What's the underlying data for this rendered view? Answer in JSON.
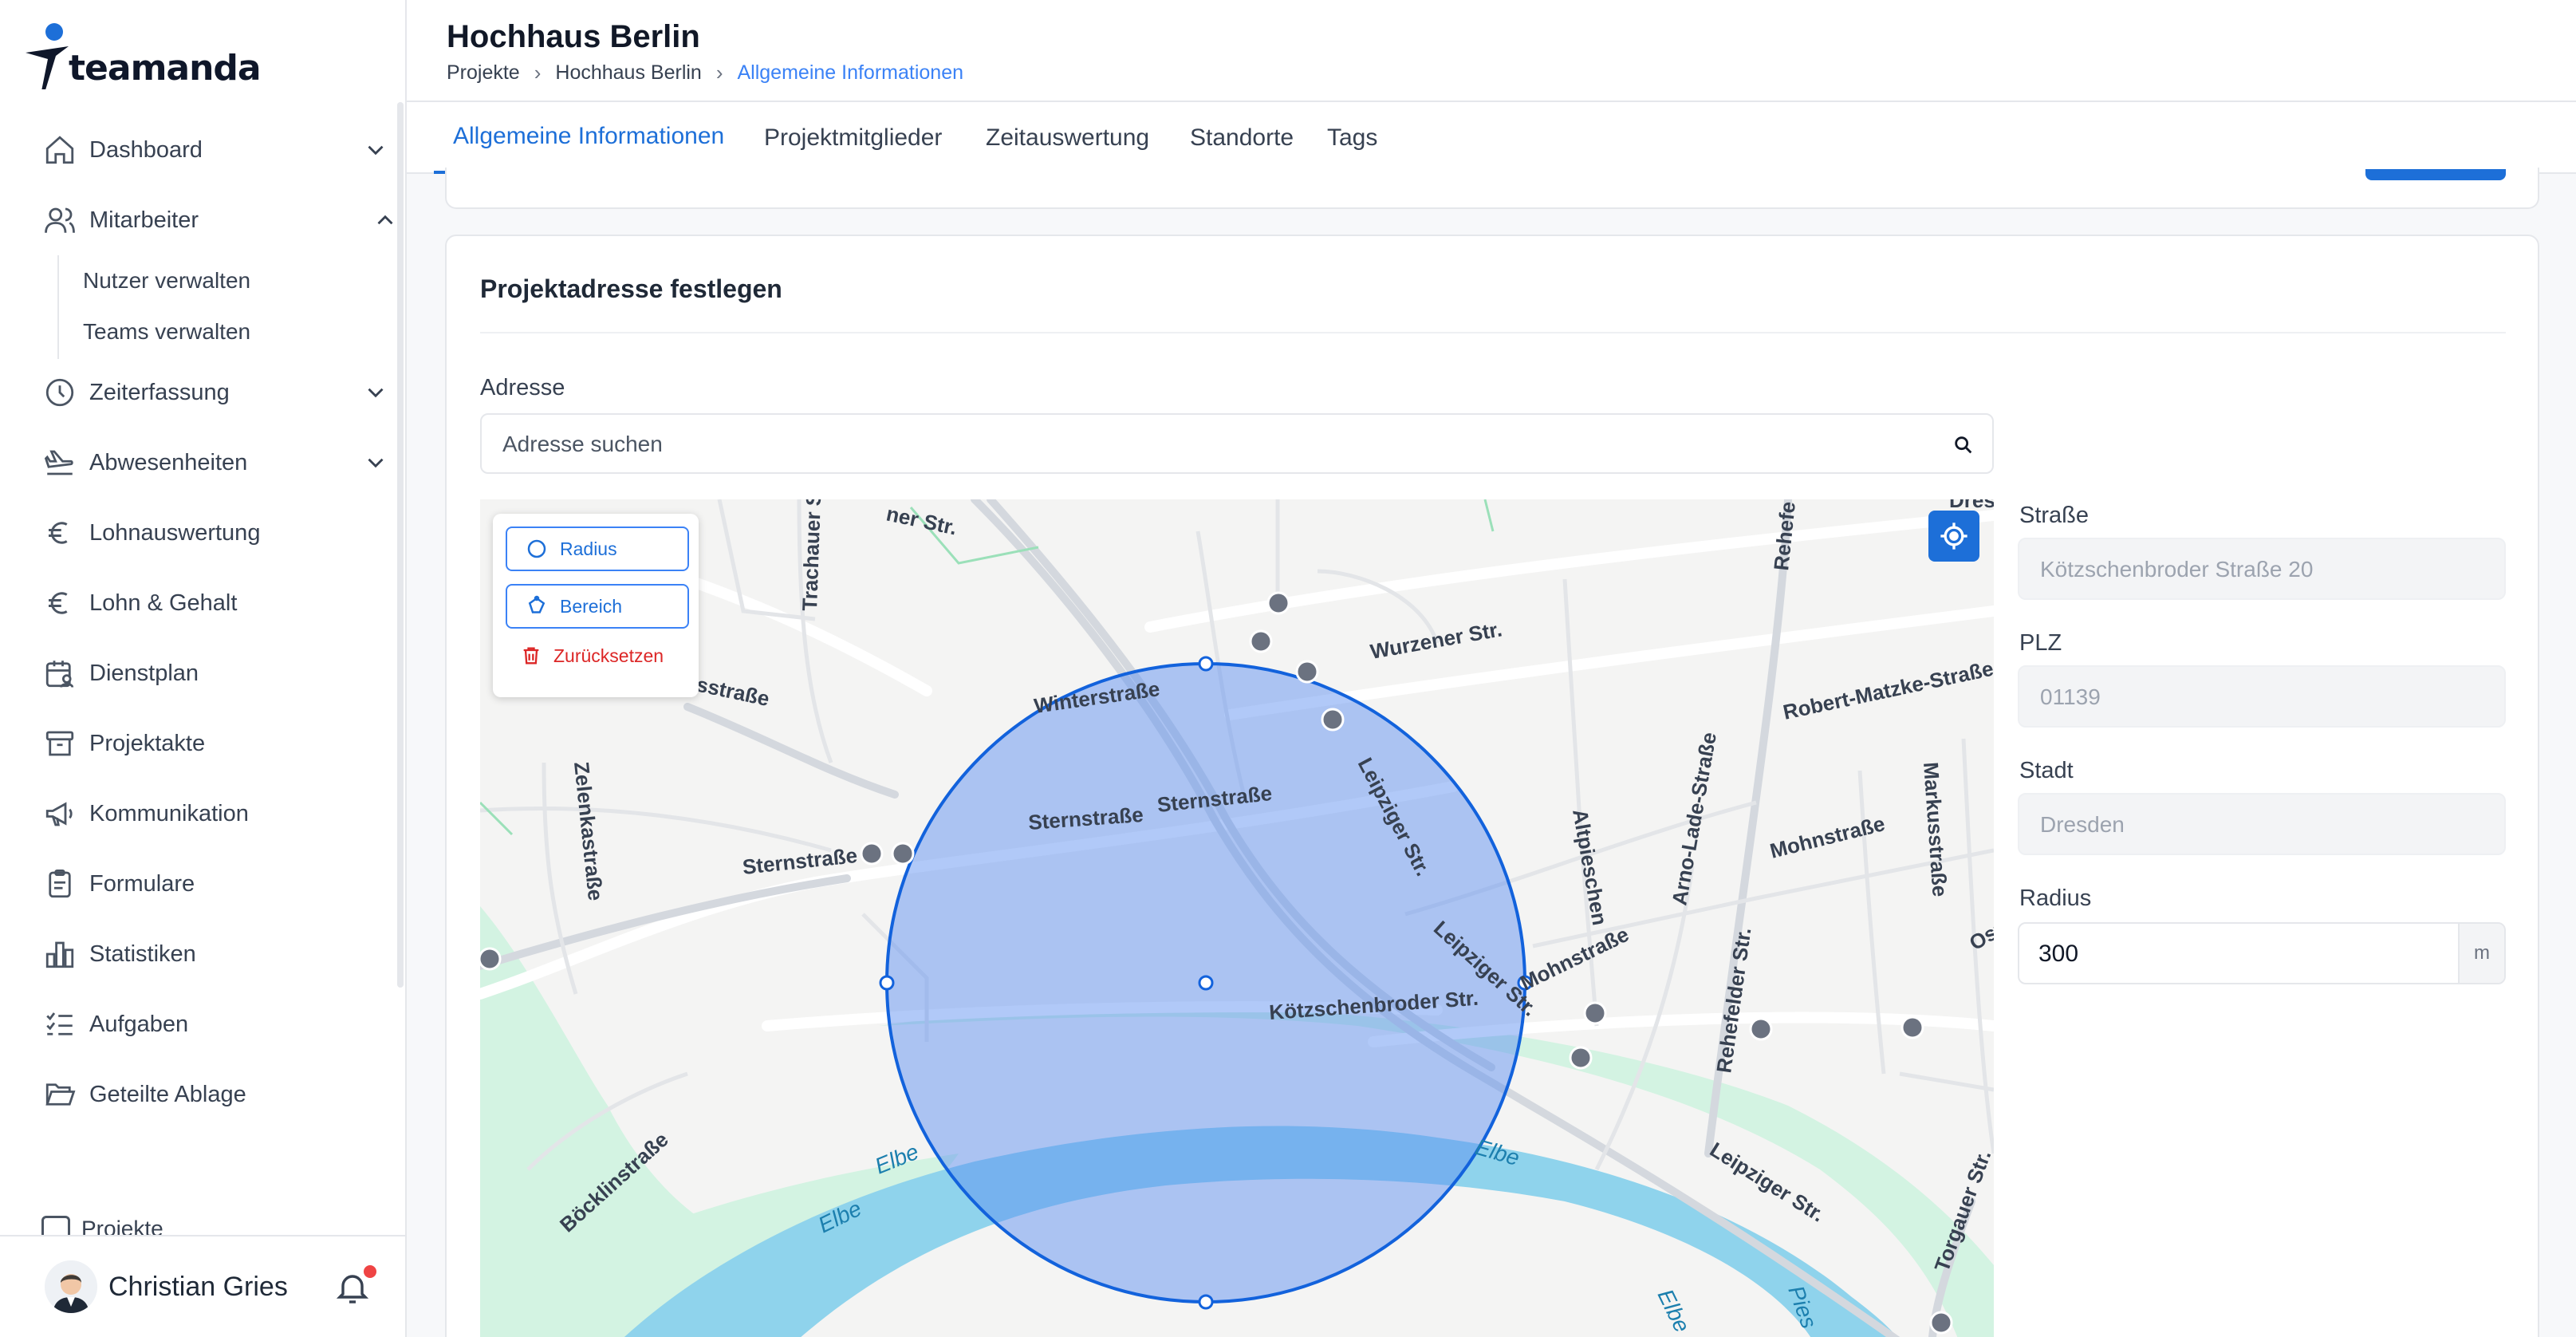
{
  "brand": {
    "name": "teamanda"
  },
  "sidebar": {
    "items": [
      {
        "label": "Dashboard",
        "icon": "home-icon"
      },
      {
        "label": "Mitarbeiter",
        "icon": "users-icon"
      },
      {
        "label": "Zeiterfassung",
        "icon": "clock-icon"
      },
      {
        "label": "Abwesenheiten",
        "icon": "plane-icon"
      },
      {
        "label": "Lohnauswertung",
        "icon": "euro-icon"
      },
      {
        "label": "Lohn & Gehalt",
        "icon": "euro-icon"
      },
      {
        "label": "Dienstplan",
        "icon": "calendar-user-icon"
      },
      {
        "label": "Projektakte",
        "icon": "archive-icon"
      },
      {
        "label": "Kommunikation",
        "icon": "megaphone-icon"
      },
      {
        "label": "Formulare",
        "icon": "clipboard-icon"
      },
      {
        "label": "Statistiken",
        "icon": "bar-chart-icon"
      },
      {
        "label": "Aufgaben",
        "icon": "checklist-icon"
      },
      {
        "label": "Geteilte Ablage",
        "icon": "folder-open-icon"
      }
    ],
    "sub_items": [
      "Nutzer verwalten",
      "Teams verwalten"
    ],
    "cut_item": "Projekte",
    "user": {
      "name": "Christian Gries"
    }
  },
  "header": {
    "title": "Hochhaus Berlin",
    "breadcrumb": [
      "Projekte",
      "Hochhaus Berlin",
      "Allgemeine Informationen"
    ]
  },
  "tabs": [
    "Allgemeine Informationen",
    "Projektmitglieder",
    "Zeitauswertung",
    "Standorte",
    "Tags"
  ],
  "address_card": {
    "title": "Projektadresse festlegen",
    "address_label": "Adresse",
    "address_placeholder": "Adresse suchen",
    "map_tools": {
      "radius": "Radius",
      "area": "Bereich",
      "reset": "Zurücksetzen"
    },
    "street_label": "Straße",
    "street_value": "Kötzschenbroder Straße 20",
    "zip_label": "PLZ",
    "zip_value": "01139",
    "city_label": "Stadt",
    "city_value": "Dresden",
    "radius_label": "Radius",
    "radius_value": "300",
    "radius_unit": "m"
  },
  "map_labels": {
    "winterstrasse": "Winterstraße",
    "sternstrasse": "Sternstraße",
    "wurzener": "Wurzener Str.",
    "leipziger": "Leipziger Str.",
    "koetzschenbroder": "Kötzschenbroder Str.",
    "robert_matzke": "Robert-Matzke-Straße",
    "mohnstrasse": "Mohnstraße",
    "altpieschen": "Altpieschen",
    "arno_lade": "Arno-Lade-Straße",
    "markusstrasse": "Markusstraße",
    "rehefelder": "Rehefelder Str.",
    "zelenka": "Zelenkastraße",
    "trachauer": "Trachauer S",
    "boecklin": "Böcklinstraße",
    "torgauer": "Torgauer Str.",
    "elbe": "Elbe",
    "er_str": "ner Str.",
    "strasse_frag": "sstraße",
    "dres": "Dres",
    "rehefe": "Rehefe",
    "ost": "Ost",
    "pies": "Pies"
  },
  "colors": {
    "accent": "#1d6fd8",
    "danger": "#dc2626",
    "circle_fill": "#5b8ff0",
    "water": "#8fd3ec",
    "park": "#cdf2df"
  }
}
